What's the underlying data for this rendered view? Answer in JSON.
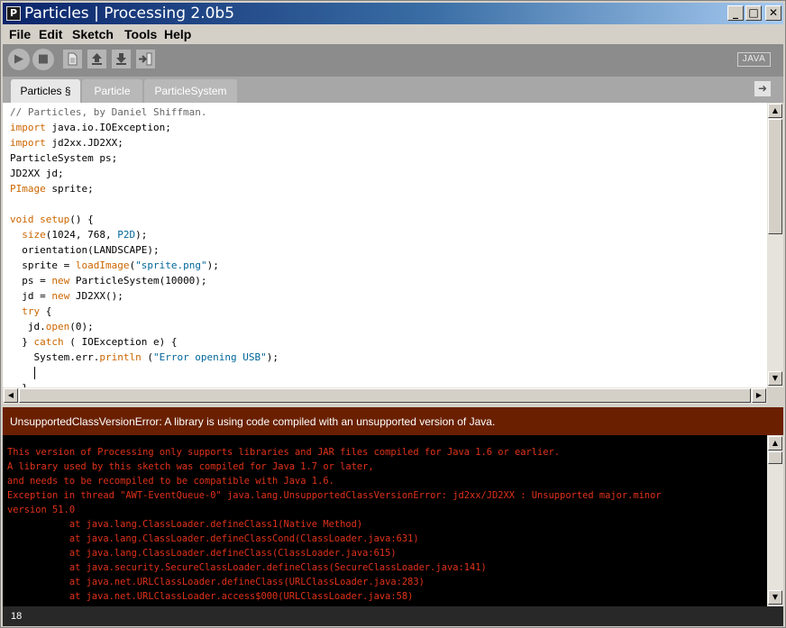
{
  "window": {
    "title": "Particles | Processing 2.0b5",
    "app_icon_letter": "P",
    "minimize_glyph": "_",
    "maximize_glyph": "□",
    "close_glyph": "✕"
  },
  "menu": {
    "file": "File",
    "edit": "Edit",
    "sketch": "Sketch",
    "tools": "Tools",
    "help": "Help"
  },
  "toolbar": {
    "run_icon": "play-icon",
    "stop_icon": "stop-icon",
    "new_icon": "new-document-icon",
    "open_icon": "open-icon",
    "save_icon": "save-icon",
    "export_icon": "export-icon",
    "mode_label": "JAVA"
  },
  "tabs": [
    {
      "label": "Particles §",
      "active": true
    },
    {
      "label": "Particle",
      "active": false
    },
    {
      "label": "ParticleSystem",
      "active": false
    }
  ],
  "tab_menu_icon": "arrow-right-icon",
  "code": {
    "l1": "// Particles, by Daniel Shiffman.",
    "l2a": "import",
    "l2b": " java.io.IOException;",
    "l3a": "import",
    "l3b": " jd2xx.JD2XX;",
    "l4": "ParticleSystem ps;",
    "l5": "JD2XX jd;",
    "l6a": "PImage",
    "l6b": " sprite;",
    "l7": "",
    "l8a": "void",
    "l8b": " ",
    "l8c": "setup",
    "l8d": "() {",
    "l9a": "  ",
    "l9b": "size",
    "l9c": "(1024, 768, ",
    "l9d": "P2D",
    "l9e": ");",
    "l10": "  orientation(LANDSCAPE);",
    "l11a": "  sprite = ",
    "l11b": "loadImage",
    "l11c": "(",
    "l11d": "\"sprite.png\"",
    "l11e": ");",
    "l12a": "  ps = ",
    "l12b": "new",
    "l12c": " ParticleSystem(10000);",
    "l13a": "  jd = ",
    "l13b": "new",
    "l13c": " JD2XX();",
    "l14a": "  ",
    "l14b": "try",
    "l14c": " {",
    "l15a": "   jd.",
    "l15b": "open",
    "l15c": "(0);",
    "l16a": "  } ",
    "l16b": "catch",
    "l16c": " ( IOException e) {",
    "l17a": "    System.err.",
    "l17b": "println",
    "l17c": " (",
    "l17d": "\"Error opening USB\"",
    "l17e": ");",
    "l18": "    ",
    "l19": "  }"
  },
  "status": {
    "message": "UnsupportedClassVersionError: A library is using code compiled with an unsupported version of Java."
  },
  "console": [
    "This version of Processing only supports libraries and JAR files compiled for Java 1.6 or earlier.",
    "A library used by this sketch was compiled for Java 1.7 or later,",
    "and needs to be recompiled to be compatible with Java 1.6.",
    "Exception in thread \"AWT-EventQueue-0\" java.lang.UnsupportedClassVersionError: jd2xx/JD2XX : Unsupported major.minor",
    "version 51.0",
    "           at java.lang.ClassLoader.defineClass1(Native Method)",
    "           at java.lang.ClassLoader.defineClassCond(ClassLoader.java:631)",
    "           at java.lang.ClassLoader.defineClass(ClassLoader.java:615)",
    "           at java.security.SecureClassLoader.defineClass(SecureClassLoader.java:141)",
    "           at java.net.URLClassLoader.defineClass(URLClassLoader.java:283)",
    "           at java.net.URLClassLoader.access$000(URLClassLoader.java:58)"
  ],
  "footer": {
    "line_number": "18"
  },
  "colors": {
    "toolbar": "#8c8c8c",
    "tabs_bar": "#a7a7a7",
    "status_bar": "#6a2000",
    "console_bg": "#000000",
    "console_text": "#e0321a",
    "keyword": "#cc6600",
    "string": "#006699"
  }
}
